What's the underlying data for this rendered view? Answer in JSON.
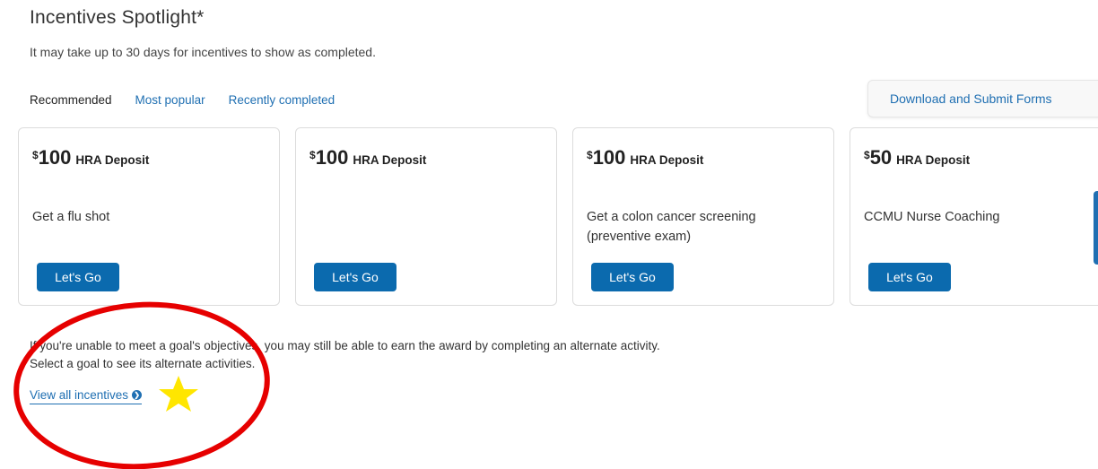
{
  "header": {
    "title": "Incentives Spotlight*",
    "subtitle": "It may take up to 30 days for incentives to show as completed."
  },
  "tabs": [
    {
      "label": "Recommended"
    },
    {
      "label": "Most popular"
    },
    {
      "label": "Recently completed"
    }
  ],
  "download_button": {
    "label": "Download and Submit Forms"
  },
  "cards": [
    {
      "currency": "$",
      "amount": "100",
      "label": "HRA Deposit",
      "description": "Get a flu shot",
      "button": "Let's Go"
    },
    {
      "currency": "$",
      "amount": "100",
      "label": "HRA Deposit",
      "description": "",
      "button": "Let's Go"
    },
    {
      "currency": "$",
      "amount": "100",
      "label": "HRA Deposit",
      "description": "Get a colon cancer screening (preventive exam)",
      "button": "Let's Go"
    },
    {
      "currency": "$",
      "amount": "50",
      "label": "HRA Deposit",
      "description": "CCMU Nurse Coaching",
      "button": "Let's Go"
    }
  ],
  "note": {
    "line1": "If you're unable to meet a goal's objectives, you may still be able to earn the award by completing an alternate activity.",
    "line2": "Select a goal to see its alternate activities."
  },
  "view_all": {
    "label": "View all incentives"
  },
  "annotations": {
    "circle_color": "#e60000",
    "star_color": "#ffe600"
  }
}
